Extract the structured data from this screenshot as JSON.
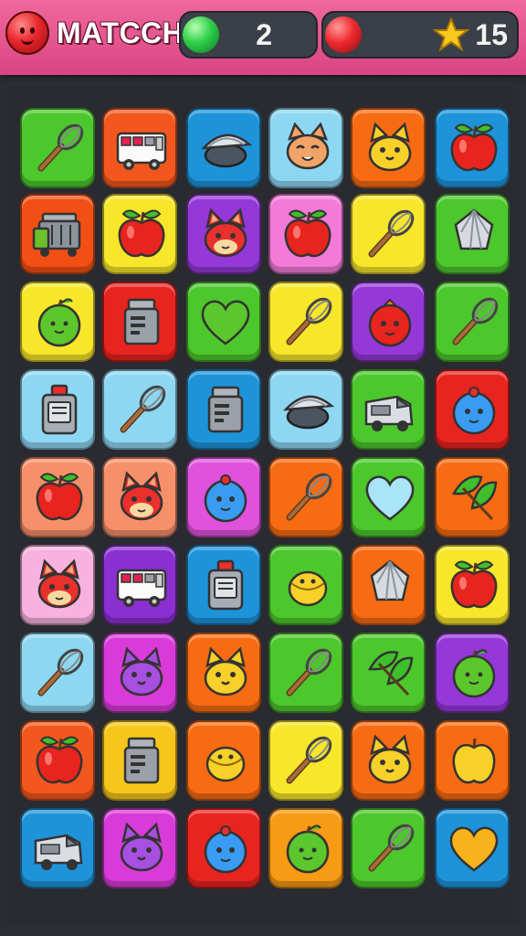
{
  "header": {
    "title": "MATCCH",
    "moves_value": "2",
    "stars_value": "15",
    "logo_color": "#e8262c",
    "moves_orb_color": "#2fcf4a",
    "stars_orb_color": "#ef2a30"
  },
  "board": {
    "rows": [
      [
        {
          "color": "#4cc72c",
          "icon": "whisk-icon"
        },
        {
          "color": "#f2581e",
          "icon": "food-truck-icon"
        },
        {
          "color": "#1e93d9",
          "icon": "clam-bowl-icon"
        },
        {
          "color": "#8ed7f2",
          "icon": "cat-face-icon"
        },
        {
          "color": "#f76b12",
          "icon": "yellow-cat-icon"
        },
        {
          "color": "#1e93d9",
          "icon": "apple-icon"
        }
      ],
      [
        {
          "color": "#f24f14",
          "icon": "trash-cart-icon"
        },
        {
          "color": "#f7e62a",
          "icon": "apple-icon"
        },
        {
          "color": "#9438d8",
          "icon": "red-cat-icon"
        },
        {
          "color": "#f27ad8",
          "icon": "apple-icon"
        },
        {
          "color": "#f7e62a",
          "icon": "whisk-icon"
        },
        {
          "color": "#4cc72c",
          "icon": "lemon-squeezer-icon"
        }
      ],
      [
        {
          "color": "#f7e62a",
          "icon": "green-ball-icon"
        },
        {
          "color": "#e82420",
          "icon": "jar-icon"
        },
        {
          "color": "#4cc72c",
          "icon": "heart-icon"
        },
        {
          "color": "#f7e62a",
          "icon": "whisk-icon"
        },
        {
          "color": "#9438d8",
          "icon": "red-ball-icon"
        },
        {
          "color": "#4cc72c",
          "icon": "whisk-icon"
        }
      ],
      [
        {
          "color": "#8ed7f2",
          "icon": "bottle-icon"
        },
        {
          "color": "#8ed7f2",
          "icon": "whisk-icon"
        },
        {
          "color": "#1e93d9",
          "icon": "jar-icon"
        },
        {
          "color": "#8ed7f2",
          "icon": "clam-bowl-icon"
        },
        {
          "color": "#4cc72c",
          "icon": "van-icon"
        },
        {
          "color": "#e82420",
          "icon": "blue-ball-icon"
        }
      ],
      [
        {
          "color": "#f7906a",
          "icon": "apple-icon"
        },
        {
          "color": "#f7906a",
          "icon": "red-cat-icon"
        },
        {
          "color": "#e052dc",
          "icon": "blue-ball-icon"
        },
        {
          "color": "#f76b12",
          "icon": "whisk-icon"
        },
        {
          "color": "#4cc72c",
          "icon": "light-heart-icon"
        },
        {
          "color": "#f76b12",
          "icon": "leaf-icon"
        }
      ],
      [
        {
          "color": "#f7b2df",
          "icon": "red-cat-icon"
        },
        {
          "color": "#8a2fd0",
          "icon": "food-truck-icon"
        },
        {
          "color": "#1e93d9",
          "icon": "bottle-icon"
        },
        {
          "color": "#4cc72c",
          "icon": "lemon-icon"
        },
        {
          "color": "#f76b12",
          "icon": "lemon-squeezer-icon"
        },
        {
          "color": "#f7e62a",
          "icon": "apple-icon"
        }
      ],
      [
        {
          "color": "#8ed7f2",
          "icon": "whisk-icon"
        },
        {
          "color": "#d83bd8",
          "icon": "purple-cat-icon"
        },
        {
          "color": "#f76b12",
          "icon": "yellow-cat-icon"
        },
        {
          "color": "#4cc72c",
          "icon": "whisk-icon"
        },
        {
          "color": "#4cc72c",
          "icon": "leaf-icon"
        },
        {
          "color": "#9438d8",
          "icon": "green-ball-icon"
        }
      ],
      [
        {
          "color": "#f2581e",
          "icon": "apple-icon"
        },
        {
          "color": "#f7c61c",
          "icon": "jar-icon"
        },
        {
          "color": "#f76b12",
          "icon": "lemon-icon"
        },
        {
          "color": "#f7e62a",
          "icon": "whisk-icon"
        },
        {
          "color": "#f76b12",
          "icon": "yellow-cat-icon"
        },
        {
          "color": "#f76b12",
          "icon": "yellow-apple-icon"
        }
      ],
      [
        {
          "color": "#1e93d9",
          "icon": "van-icon"
        },
        {
          "color": "#d83bd8",
          "icon": "purple-cat-icon"
        },
        {
          "color": "#e82420",
          "icon": "blue-ball-icon"
        },
        {
          "color": "#f79a14",
          "icon": "green-ball-icon"
        },
        {
          "color": "#4cc72c",
          "icon": "whisk-icon"
        },
        {
          "color": "#1e93d9",
          "icon": "gold-heart-icon"
        }
      ]
    ]
  }
}
